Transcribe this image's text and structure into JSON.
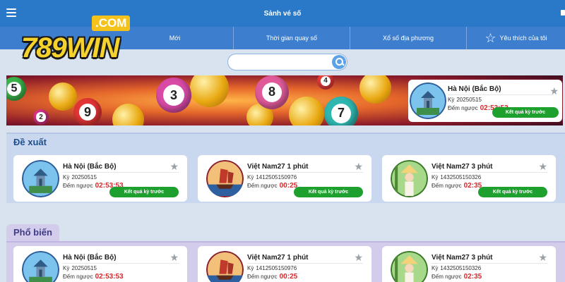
{
  "topbar": {
    "title": "Sảnh vé số"
  },
  "logo": {
    "dotcom": ".COM",
    "brand": "789WIN"
  },
  "nav": [
    {
      "label": "Mới"
    },
    {
      "label": "Thời gian quay số"
    },
    {
      "label": "Xổ số địa phương"
    },
    {
      "label": "Yêu thích của tôi",
      "icon": "star-outline-icon"
    }
  ],
  "search": {
    "value": "",
    "placeholder": ""
  },
  "banner": {
    "balls": [
      "5",
      "2",
      "9",
      "3",
      "8",
      "4",
      "7"
    ],
    "featured": {
      "name": "Hà Nội (Bắc Bộ)",
      "period_label": "Kỳ",
      "period": "20250515",
      "countdown_label": "Đếm ngược",
      "countdown": "02:53:53",
      "button": "Kết quả kỳ trước"
    }
  },
  "sections": [
    {
      "title": "Đề xuất",
      "cards": [
        {
          "name": "Hà Nội (Bắc Bộ)",
          "period_label": "Kỳ",
          "period": "20250515",
          "countdown_label": "Đếm ngược",
          "countdown": "02:53:53",
          "button": "Kết quả kỳ trước",
          "avatar": "pagoda"
        },
        {
          "name": "Việt Nam27 1 phút",
          "period_label": "Kỳ",
          "period": "1412505150976",
          "countdown_label": "Đếm ngược",
          "countdown": "00:25",
          "button": "Kết quả kỳ trước",
          "avatar": "junk-boat"
        },
        {
          "name": "Việt Nam27 3 phút",
          "period_label": "Kỳ",
          "period": "1432505150326",
          "countdown_label": "Đếm ngược",
          "countdown": "02:35",
          "button": "Kết quả kỳ trước",
          "avatar": "conical-hat-woman"
        }
      ]
    },
    {
      "title": "Phổ biến",
      "cards": [
        {
          "name": "Hà Nội (Bắc Bộ)",
          "period_label": "Kỳ",
          "period": "20250515",
          "countdown_label": "Đếm ngược",
          "countdown": "02:53:53",
          "avatar": "pagoda"
        },
        {
          "name": "Việt Nam27 1 phút",
          "period_label": "Kỳ",
          "period": "1412505150976",
          "countdown_label": "Đếm ngược",
          "countdown": "00:25",
          "avatar": "junk-boat"
        },
        {
          "name": "Việt Nam27 3 phút",
          "period_label": "Kỳ",
          "period": "1432505150326",
          "countdown_label": "Đếm ngược",
          "countdown": "02:35",
          "avatar": "conical-hat-woman"
        }
      ]
    }
  ],
  "colors": {
    "topbar": "#2a79c8",
    "navbar": "#3d7fce",
    "button": "#1ea02f",
    "countdown": "#d8272a",
    "logo": "#f6d22c"
  }
}
